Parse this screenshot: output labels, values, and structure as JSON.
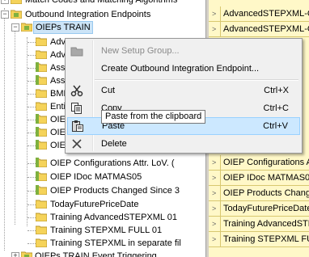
{
  "tree": {
    "top_partial": "Match Codes and Matching Algorithms",
    "outbound_endpoints": "Outbound Integration Endpoints",
    "oieps_train": "OIEPs TRAIN",
    "children": [
      "Adv",
      "Adv",
      "Asse",
      "Asse",
      "BME",
      "Enti",
      "OIEI",
      "OIEI",
      "OIEI",
      "OIEP Configurations Attr. LoV. (",
      "OIEP IDoc MATMAS05",
      "OIEP Products Changed Since 3",
      "TodayFuturePriceDate",
      "Training AdvancedSTEPXML 01",
      "Training STEPXML FULL 01",
      "Training STEPXML in separate fil"
    ],
    "bottom_partial": "OIEPs TRAIN Event Triggering"
  },
  "right_list": [
    "AdvancedSTEPXML-Chang",
    "AdvancedSTEPXML-Chang",
    "OIEP Configurations Attr.",
    "OIEP IDoc MATMAS05",
    "OIEP Products Changed S",
    "TodayFuturePriceDate",
    "Training AdvancedSTEPXM",
    "Training STEPXML FULL 01"
  ],
  "context_menu": {
    "new_setup_group": "New Setup Group...",
    "create_endpoint": "Create Outbound Integration Endpoint...",
    "cut": "Cut",
    "cut_shortcut": "Ctrl+X",
    "copy": "Copy",
    "copy_shortcut": "Ctrl+C",
    "paste": "Paste",
    "paste_shortcut": "Ctrl+V",
    "delete": "Delete"
  },
  "tooltip": "Paste from the clipboard",
  "colors": {
    "folder": "#f5d35a",
    "endpoint_green": "#7fb13f",
    "selection": "#cce4f7",
    "menu_highlight": "#cce8ff",
    "right_list_bg": "#fff8c8"
  }
}
